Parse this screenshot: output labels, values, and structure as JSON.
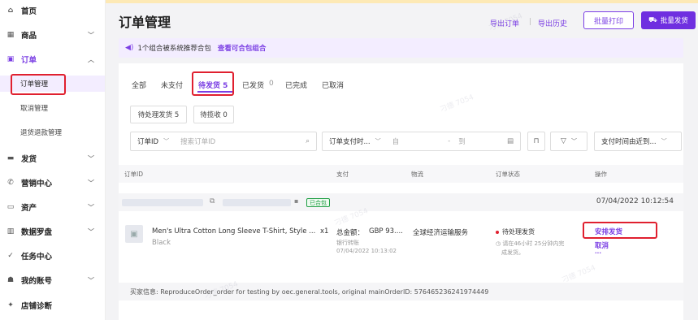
{
  "sidebar": {
    "items": [
      {
        "label": "首页",
        "icon": "home-icon",
        "glyph": "⌂"
      },
      {
        "label": "商品",
        "icon": "goods-icon",
        "glyph": "▦"
      },
      {
        "label": "订单",
        "icon": "order-icon",
        "glyph": "▣"
      },
      {
        "label": "发货",
        "icon": "shipping-icon",
        "glyph": "▬"
      },
      {
        "label": "营销中心",
        "icon": "marketing-icon",
        "glyph": "✆"
      },
      {
        "label": "资产",
        "icon": "assets-icon",
        "glyph": "▭"
      },
      {
        "label": "数据罗盘",
        "icon": "data-icon",
        "glyph": "▥"
      },
      {
        "label": "任务中心",
        "icon": "task-icon",
        "glyph": "✓"
      },
      {
        "label": "我的账号",
        "icon": "account-icon",
        "glyph": "☗"
      },
      {
        "label": "店铺诊断",
        "icon": "diagnosis-icon",
        "glyph": "✦"
      }
    ],
    "order_sub": [
      "订单管理",
      "取消管理",
      "退货退款管理"
    ]
  },
  "header": {
    "title": "订单管理",
    "export_order": "导出订单",
    "separator": "|",
    "export_history": "导出历史",
    "batch_print": "批量打印",
    "batch_ship": "批量发货"
  },
  "banner": {
    "text": "1个组合被系统推荐合包",
    "link": "查看可合包组合"
  },
  "tabs": [
    "全部",
    "未支付",
    "待发货 5",
    "已发货",
    "0",
    "已完成",
    "已取消"
  ],
  "chips": [
    "待处理发货 5",
    "待揽收 0"
  ],
  "filters": {
    "field": "订单ID",
    "search_placeholder": "搜索订单ID",
    "time_field": "订单支付时...",
    "from": "自",
    "to": "到",
    "sort": "支付时间由近到..."
  },
  "columns": [
    "订单ID",
    "支付",
    "物流",
    "订单状态",
    "操作"
  ],
  "group": {
    "tag": "已合包",
    "date": "07/04/2022 10:12:54"
  },
  "order": {
    "product_name": "Men's Ultra Cotton Long Sleeve T-Shirt, Style ...",
    "variant": "Black",
    "qty": "x1",
    "total_label": "总金额：",
    "total_value": "GBP 93....",
    "payment_method": "银行转账",
    "pay_time": "07/04/2022 10:13:02",
    "logistics": "全球经济运输服务",
    "status": "待处理发货",
    "status_note_1": "请在46小时 25分钟内完",
    "status_note_2": "成发货。",
    "action_ship": "安排发货",
    "action_cancel": "取消",
    "action_more": "···"
  },
  "buyer_info": "买家信息: ReproduceOrder_order for testing by oec.general.tools, original mainOrderID: 576465236241974449",
  "watermark": "刁德 7054",
  "colors": {
    "accent": "#7b3fe4",
    "highlight": "#e0202f",
    "success": "#22a046"
  }
}
